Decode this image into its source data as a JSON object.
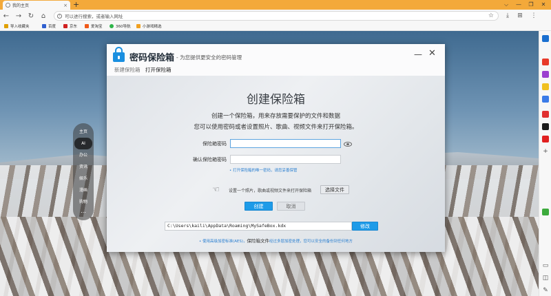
{
  "browser": {
    "tab_title": "我的主页",
    "tab_close": "×",
    "new_tab": "+",
    "window_controls": [
      "⌵",
      "—",
      "❐",
      "✕"
    ],
    "address_placeholder": "可以进行搜索，或者输入网址",
    "bookmarks": [
      {
        "label": "导入收藏夹",
        "color": "#e0a000"
      },
      {
        "label": "百度",
        "color": "#3060d0"
      },
      {
        "label": "京东",
        "color": "#d02020"
      },
      {
        "label": "爱淘宝",
        "color": "#f05a1a"
      },
      {
        "label": "360导航",
        "color": "#2fb54a"
      },
      {
        "label": "小游戏精选",
        "color": "#f0a020"
      }
    ]
  },
  "side_menu": {
    "items": [
      {
        "label": "主页",
        "active": false
      },
      {
        "label": "AI",
        "active": true
      },
      {
        "label": "办公",
        "active": false
      },
      {
        "label": "资讯",
        "active": false
      },
      {
        "label": "娱乐",
        "active": false
      },
      {
        "label": "漫画",
        "active": false
      },
      {
        "label": "购物",
        "active": false
      }
    ],
    "more": "⋯"
  },
  "dialog": {
    "title": "密码保险箱",
    "subtitle": "- 为您提供更安全的密码管理",
    "tabs": [
      "新建保险箱",
      "打开保险箱"
    ],
    "minimize": "—",
    "close": "✕",
    "heading": "创建保险箱",
    "desc_line1": "创建一个保险箱，用来存放需要保护的文件和数据",
    "desc_line2": "您可以使用密码或者设置照片、歌曲、视频文件来打开保险箱。",
    "password_label": "保险箱密码",
    "password_value": "",
    "confirm_label": "确认保险箱密码",
    "confirm_value": "",
    "password_hint": "• 打开保险箱的唯一密码，请您妥善保管",
    "photo_text": "设置一个照片，歌曲或视频文件来打开保险箱",
    "choose_file": "选择文件",
    "create": "创建",
    "cancel": "取消",
    "file_label": "保险箱文件",
    "file_path": "C:\\Users\\kaili\\AppData\\Roaming\\MySafeBox.kdx",
    "modify": "修改",
    "footer_left": "• 使用高级加密标准(AES)，",
    "footer_mid": "保险箱文件",
    "footer_right": "经过多层加密处理，您可以安全的备份到任何地方"
  },
  "colors": {
    "accent": "#1e9be8",
    "tabbar": "#f3a93a",
    "hint": "#2a7fd0"
  }
}
